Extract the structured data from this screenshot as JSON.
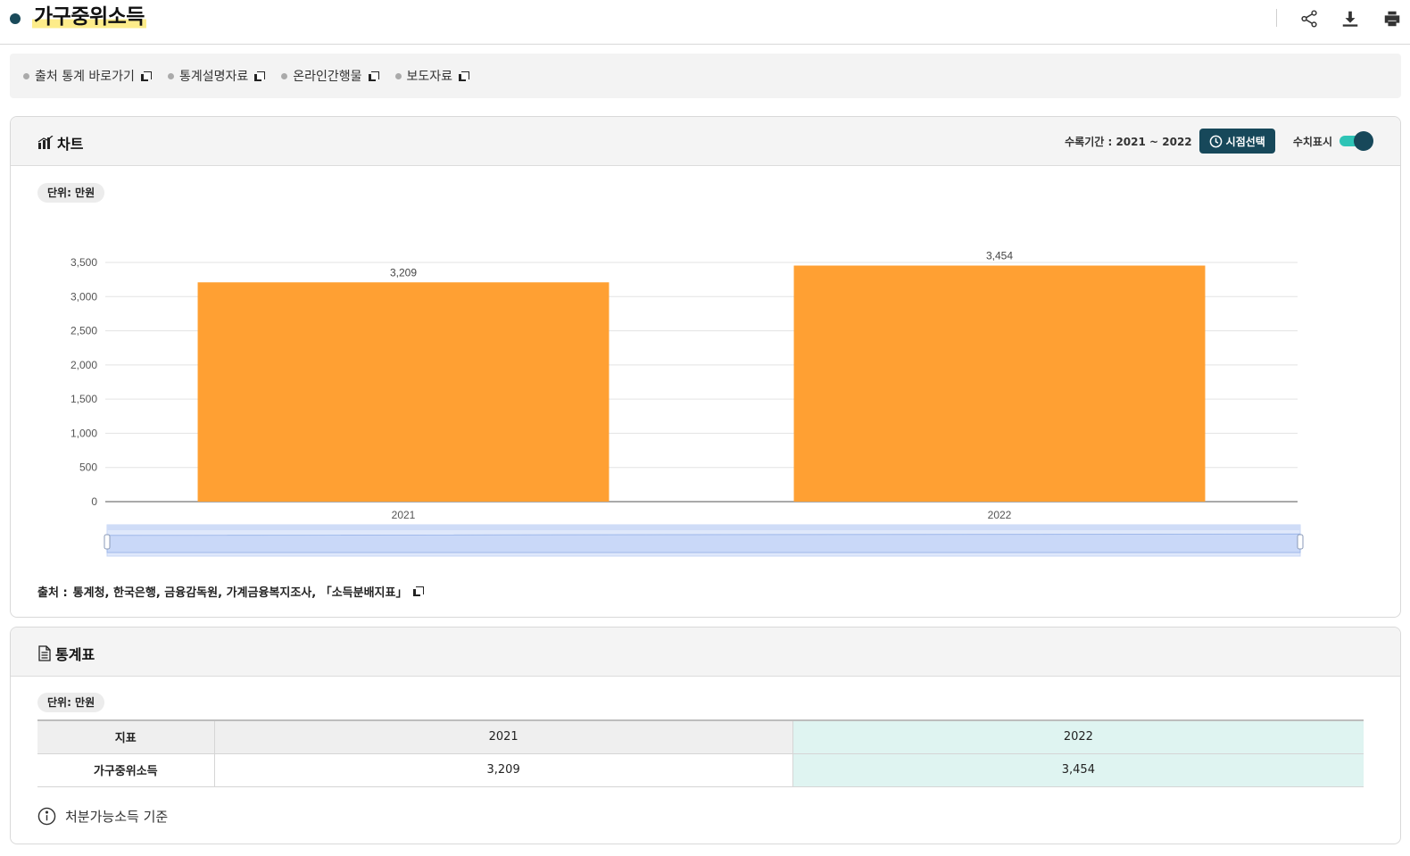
{
  "header": {
    "title": "가구중위소득",
    "actions": {
      "share_icon": "share-icon",
      "download_icon": "download-icon",
      "print_icon": "print-icon"
    }
  },
  "links": [
    {
      "label": "출처 통계 바로가기"
    },
    {
      "label": "통계설명자료"
    },
    {
      "label": "온라인간행물"
    },
    {
      "label": "보도자료"
    }
  ],
  "chart_panel": {
    "title": "차트",
    "period_label": "수록기간 : 2021 ~ 2022",
    "time_button": "시점선택",
    "value_toggle_label": "수치표시",
    "value_toggle_on": true,
    "unit": "단위: 만원",
    "source_label": "출처 :",
    "source_text": "통계청, 한국은행, 금융감독원, 가계금융복지조사, 「소득분배지표」"
  },
  "chart_data": {
    "type": "bar",
    "categories": [
      "2021",
      "2022"
    ],
    "series": [
      {
        "values": [
          3209,
          3454
        ],
        "color": "#ffa033"
      }
    ],
    "data_labels": [
      "3,209",
      "3,454"
    ],
    "y_ticks": [
      "0",
      "500",
      "1,000",
      "1,500",
      "2,000",
      "2,500",
      "3,000",
      "3,500"
    ],
    "ylim": [
      0,
      3500
    ],
    "grid": true,
    "legend": "none"
  },
  "table_panel": {
    "title": "통계표",
    "unit": "단위: 만원",
    "headers": [
      "지표",
      "2021",
      "2022"
    ],
    "rows": [
      {
        "indicator": "가구중위소득",
        "values": [
          "3,209",
          "3,454"
        ]
      }
    ],
    "note": "처분가능소득 기준"
  },
  "colors": {
    "accent": "#17485a",
    "bar": "#ffa033",
    "toggle": "#2ec4b6",
    "highlight_col": "#dff4f1"
  }
}
